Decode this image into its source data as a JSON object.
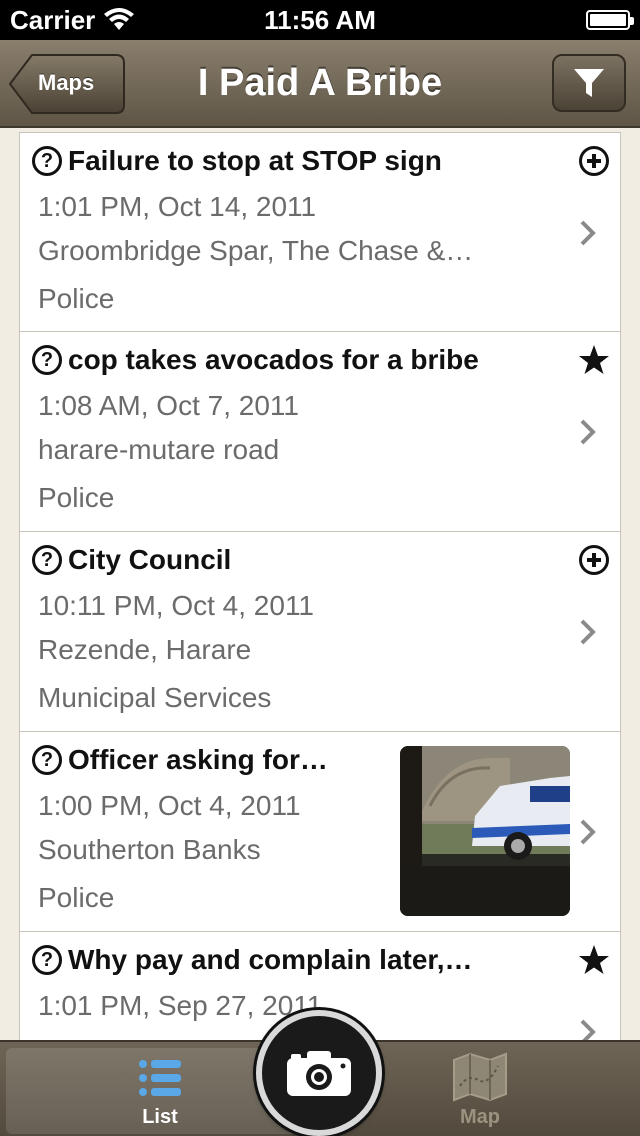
{
  "status_bar": {
    "carrier": "Carrier",
    "time": "11:56 AM"
  },
  "nav": {
    "back_label": "Maps",
    "title": "I Paid A Bribe",
    "filter_icon": "filter-icon"
  },
  "reports": [
    {
      "title": "Failure to stop at STOP sign",
      "time": "1:01 PM, Oct 14, 2011",
      "location": "Groombridge Spar, The Chase &…",
      "category": "Police",
      "badge": "plus-circle-icon"
    },
    {
      "title": "cop takes avocados for a bribe",
      "time": "1:08 AM, Oct 7, 2011",
      "location": "harare-mutare road",
      "category": "Police",
      "badge": "star-icon"
    },
    {
      "title": "City Council",
      "time": "10:11 PM, Oct 4, 2011",
      "location": "Rezende, Harare",
      "category": "Municipal Services",
      "badge": "plus-circle-icon"
    },
    {
      "title": "Officer asking for…",
      "time": "1:00 PM, Oct 4, 2011",
      "location": "Southerton Banks",
      "category": "Police",
      "badge": "photo-thumbnail"
    },
    {
      "title": "Why pay and complain later,…",
      "time": "1:01 PM, Sep 27, 2011",
      "location": "",
      "category": "",
      "badge": "star-icon"
    }
  ],
  "tabs": {
    "list_label": "List",
    "map_label": "Map"
  },
  "colors": {
    "nav_bar": "#6e6556",
    "background": "#f1ede2",
    "secondary_text": "#6b6b6b"
  }
}
